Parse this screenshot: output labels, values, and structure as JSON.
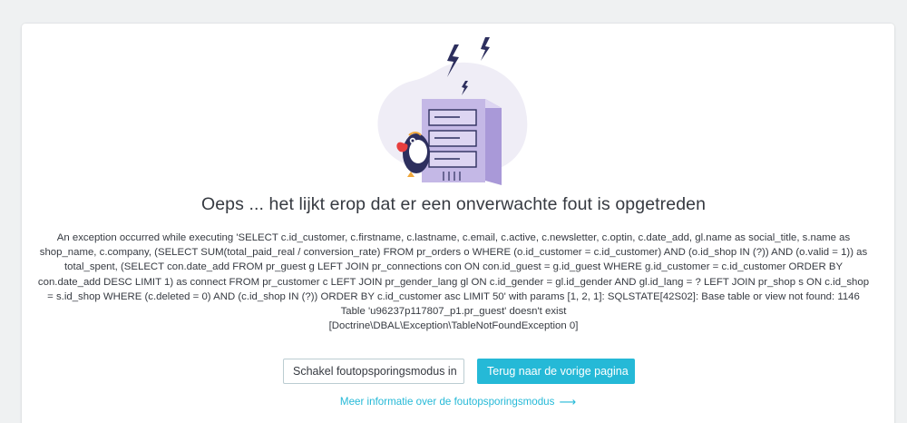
{
  "error_page": {
    "title": "Oeps ... het lijkt erop dat er een onverwachte fout is opgetreden",
    "message": "An exception occurred while executing 'SELECT c.id_customer, c.firstname, c.lastname, c.email, c.active, c.newsletter, c.optin, c.date_add, gl.name as social_title, s.name as shop_name, c.company, (SELECT SUM(total_paid_real / conversion_rate) FROM pr_orders o WHERE (o.id_customer = c.id_customer) AND (o.id_shop IN (?)) AND (o.valid = 1)) as total_spent, (SELECT con.date_add FROM pr_guest g LEFT JOIN pr_connections con ON con.id_guest = g.id_guest WHERE g.id_customer = c.id_customer ORDER BY con.date_add DESC LIMIT 1) as connect FROM pr_customer c LEFT JOIN pr_gender_lang gl ON c.id_gender = gl.id_gender AND gl.id_lang = ? LEFT JOIN pr_shop s ON c.id_shop = s.id_shop WHERE (c.deleted = 0) AND (c.id_shop IN (?)) ORDER BY c.id_customer asc LIMIT 50' with params [1, 2, 1]: SQLSTATE[42S02]: Base table or view not found: 1146 Table 'u96237p117807_p1.pr_guest' doesn't exist",
    "exception_class": "[Doctrine\\DBAL\\Exception\\TableNotFoundException 0]",
    "buttons": {
      "enable_debug": "Schakel foutopsporingsmodus in",
      "go_back": "Terug naar de vorige pagina"
    },
    "more_info_link": "Meer informatie over de foutopsporingsmodus",
    "icons": {
      "illustration": "server-with-puffin-illustration",
      "arrow": "arrow-right-icon"
    },
    "colors": {
      "primary": "#25b9d7",
      "text": "#363a41",
      "server": "#c4b8e6",
      "background": "#eff1f2"
    }
  }
}
